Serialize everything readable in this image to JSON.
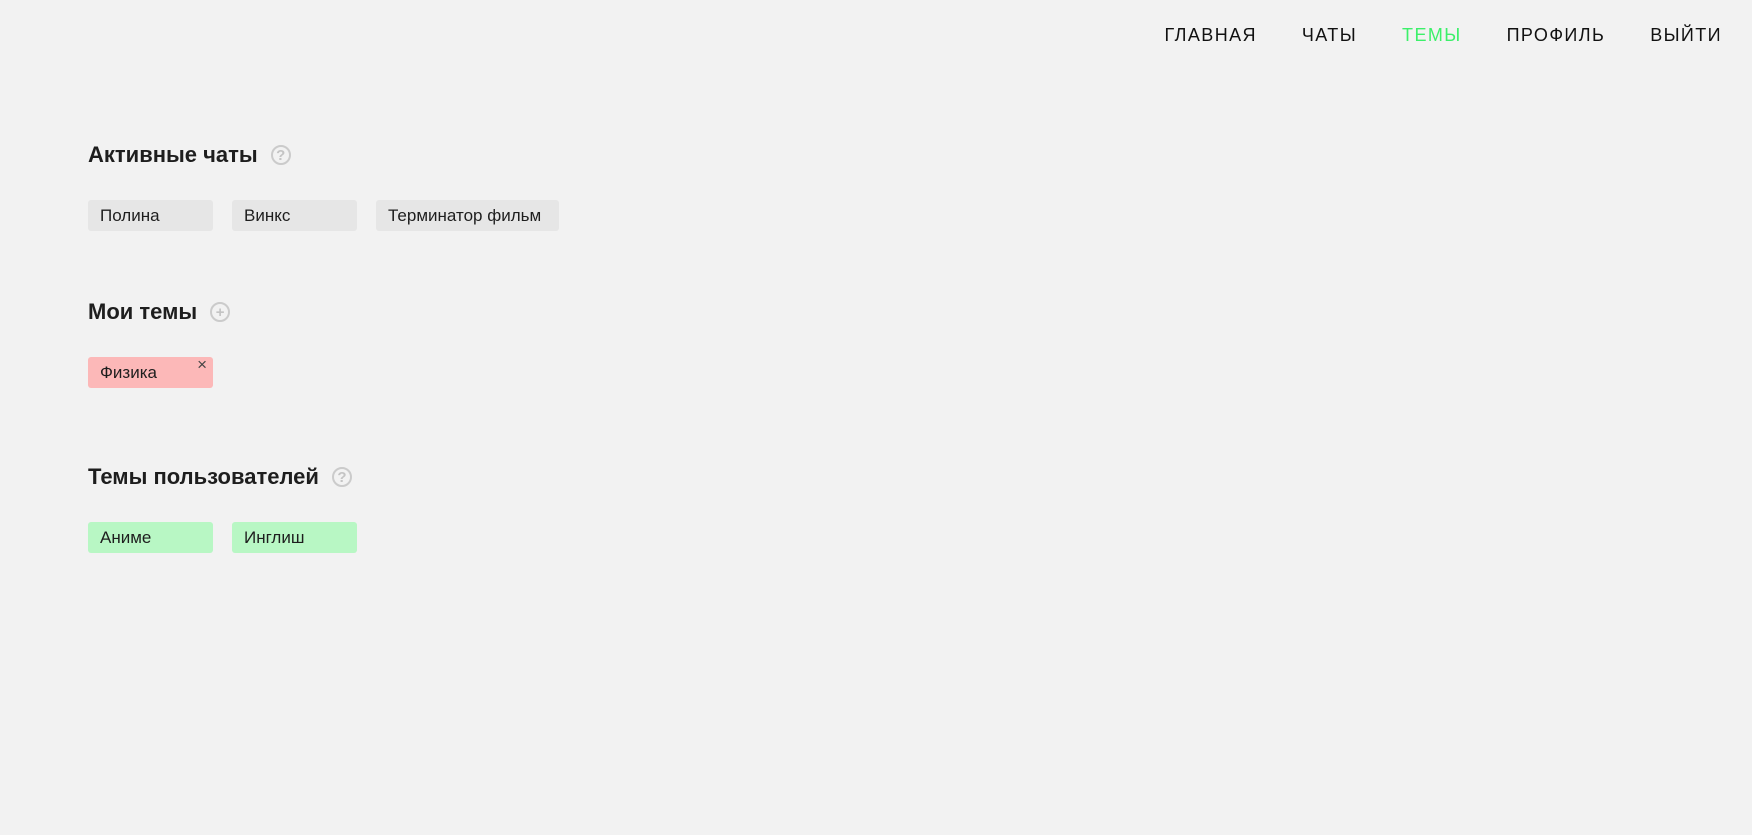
{
  "nav": {
    "items": [
      {
        "label": "ГЛАВНАЯ"
      },
      {
        "label": "ЧАТЫ"
      },
      {
        "label": "ТЕМЫ"
      },
      {
        "label": "ПРОФИЛЬ"
      },
      {
        "label": "ВЫЙТИ"
      }
    ],
    "active_color": "#3cf06a"
  },
  "active_chats": {
    "title": "Активные чаты",
    "icon": "help-icon",
    "chips": [
      {
        "label": "Полина"
      },
      {
        "label": "Винкс"
      },
      {
        "label": "Терминатор фильм"
      }
    ]
  },
  "my_topics": {
    "title": "Мои темы",
    "icon": "add-icon",
    "chips": [
      {
        "label": "Физика",
        "close_icon": "×"
      }
    ],
    "chip_color": "#fcb8b8"
  },
  "user_topics": {
    "title": "Темы пользователей",
    "icon": "help-icon",
    "chips": [
      {
        "label": "Аниме"
      },
      {
        "label": "Инглиш"
      }
    ],
    "chip_color": "#b8f7c4"
  }
}
